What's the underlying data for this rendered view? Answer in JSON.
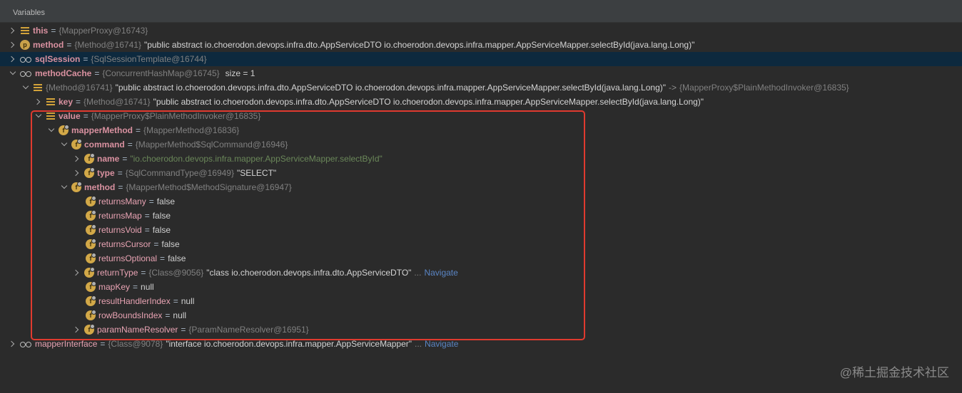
{
  "panel": {
    "title": "Variables"
  },
  "rows": [
    {
      "name": "this",
      "ref": "{MapperProxy@16743}"
    },
    {
      "name": "method",
      "ref": "{Method@16741}",
      "str": "\"public abstract io.choerodon.devops.infra.dto.AppServiceDTO io.choerodon.devops.infra.mapper.AppServiceMapper.selectById(java.lang.Long)\""
    },
    {
      "name": "sqlSession",
      "ref": "{SqlSessionTemplate@16744}"
    },
    {
      "name": "methodCache",
      "ref": "{ConcurrentHashMap@16745}",
      "extra": "size = 1"
    },
    {
      "ref": "{Method@16741}",
      "str": "\"public abstract io.choerodon.devops.infra.dto.AppServiceDTO io.choerodon.devops.infra.mapper.AppServiceMapper.selectById(java.lang.Long)\"",
      "arrow": "->",
      "ref2": "{MapperProxy$PlainMethodInvoker@16835}"
    },
    {
      "name": "key",
      "ref": "{Method@16741}",
      "str": "\"public abstract io.choerodon.devops.infra.dto.AppServiceDTO io.choerodon.devops.infra.mapper.AppServiceMapper.selectById(java.lang.Long)\""
    },
    {
      "name": "value",
      "ref": "{MapperProxy$PlainMethodInvoker@16835}"
    },
    {
      "name": "mapperMethod",
      "ref": "{MapperMethod@16836}"
    },
    {
      "name": "command",
      "ref": "{MapperMethod$SqlCommand@16946}"
    },
    {
      "name": "name",
      "str": "\"io.choerodon.devops.infra.mapper.AppServiceMapper.selectById\""
    },
    {
      "name": "type",
      "ref": "{SqlCommandType@16949}",
      "str": "\"SELECT\""
    },
    {
      "name": "method",
      "ref": "{MapperMethod$MethodSignature@16947}"
    },
    {
      "name": "returnsMany",
      "val": "false"
    },
    {
      "name": "returnsMap",
      "val": "false"
    },
    {
      "name": "returnsVoid",
      "val": "false"
    },
    {
      "name": "returnsCursor",
      "val": "false"
    },
    {
      "name": "returnsOptional",
      "val": "false"
    },
    {
      "name": "returnType",
      "ref": "{Class@9056}",
      "str": "\"class io.choerodon.devops.infra.dto.AppServiceDTO\"",
      "dots": "...",
      "nav": "Navigate"
    },
    {
      "name": "mapKey",
      "val": "null"
    },
    {
      "name": "resultHandlerIndex",
      "val": "null"
    },
    {
      "name": "rowBoundsIndex",
      "val": "null"
    },
    {
      "name": "paramNameResolver",
      "ref": "{ParamNameResolver@16951}"
    },
    {
      "name": "mapperInterface",
      "ref": "{Class@9078}",
      "str": "\"interface io.choerodon.devops.infra.mapper.AppServiceMapper\"",
      "dots": "...",
      "nav": "Navigate"
    }
  ],
  "eq": "=",
  "watermark": "@稀土掘金技术社区",
  "colors": {
    "background": "#2b2b2b",
    "selected": "#0d293e",
    "highlight_border": "#e03a2f",
    "link": "#5a85c4"
  }
}
